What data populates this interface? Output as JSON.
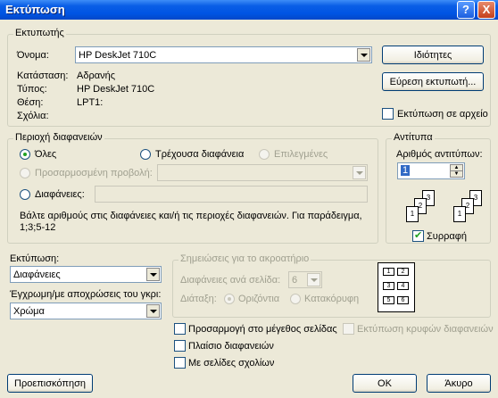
{
  "title": "Εκτύπωση",
  "title_buttons": {
    "help": "?",
    "close": "X"
  },
  "printer": {
    "group_label": "Εκτυπωτής",
    "name_label": "Όνομα:",
    "name_value": "HP DeskJet 710C",
    "status_label": "Κατάσταση:",
    "status_value": "Αδρανής",
    "type_label": "Τύπος:",
    "type_value": "HP DeskJet 710C",
    "where_label": "Θέση:",
    "where_value": "LPT1:",
    "comment_label": "Σχόλια:",
    "properties_button": "Ιδιότητες",
    "find_printer_button": "Εύρεση εκτυπωτή...",
    "print_to_file_label": "Εκτύπωση σε αρχείο"
  },
  "range": {
    "group_label": "Περιοχή διαφανειών",
    "all_label": "Όλες",
    "current_label": "Τρέχουσα διαφάνεια",
    "selection_label": "Επιλεγμένες",
    "custom_show_label": "Προσαρμοσμένη προβολή:",
    "slides_label": "Διαφάνειες:",
    "hint": "Βάλτε αριθμούς στις διαφάνειες και/ή τις περιοχές διαφανειών. Για παράδειγμα,",
    "hint_example": "1;3;5-12"
  },
  "copies": {
    "group_label": "Αντίτυπα",
    "number_label": "Αριθμός αντιτύπων:",
    "number_value": "1",
    "collate_label": "Συρραφή",
    "collate_checked": true,
    "pages_a": [
      "1",
      "2",
      "3"
    ],
    "pages_b": [
      "1",
      "2",
      "3"
    ]
  },
  "print_what": {
    "label": "Εκτύπωση:",
    "value": "Διαφάνειες",
    "color_label": "Έγχρωμη/με αποχρώσεις του γκρι:",
    "color_value": "Χρώμα"
  },
  "handouts": {
    "group_label": "Σημειώσεις για το ακροατήριο",
    "per_page_label": "Διαφάνειες ανά σελίδα:",
    "per_page_value": "6",
    "order_label": "Διάταξη:",
    "horizontal_label": "Οριζόντια",
    "vertical_label": "Κατακόρυφη",
    "thumbs": [
      "1",
      "2",
      "3",
      "4",
      "5",
      "6"
    ]
  },
  "options": {
    "scale_label": "Προσαρμογή στο μέγεθος σελίδας",
    "frame_label": "Πλαίσιο διαφανειών",
    "comments_label": "Με σελίδες σχολίων",
    "hidden_label": "Εκτύπωση κρυφών διαφανειών"
  },
  "footer": {
    "preview_button": "Προεπισκόπηση",
    "ok_button": "OK",
    "cancel_button": "Άκυρο"
  },
  "colors": {
    "title_bar": "#0054e3",
    "dialog_bg": "#ece9d8"
  }
}
